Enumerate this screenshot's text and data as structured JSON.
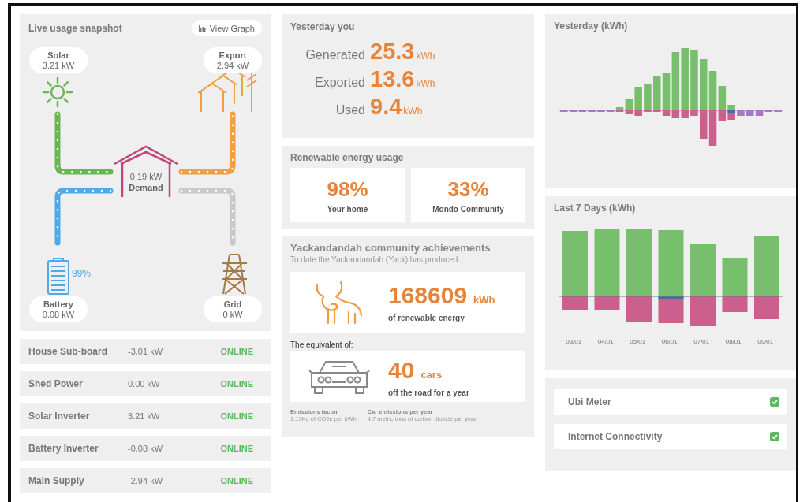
{
  "live": {
    "title": "Live usage snapshot",
    "graph_button": "View Graph",
    "nodes": [
      {
        "kind": "solar",
        "label": "Solar",
        "value": "3.21 kW"
      },
      {
        "kind": "export",
        "label": "Export",
        "value": "2.94 kW"
      },
      {
        "kind": "battery",
        "label": "Battery",
        "value": "0.08 kW",
        "charge": "99%"
      },
      {
        "kind": "grid",
        "label": "Grid",
        "value": "0 kW"
      }
    ],
    "demand": {
      "value": "0.19 kW",
      "label": "Demand"
    }
  },
  "circuits": [
    {
      "name": "House Sub-board",
      "power": "-3.01 kW",
      "status": "ONLINE"
    },
    {
      "name": "Shed Power",
      "power": "0.00 kW",
      "status": "ONLINE"
    },
    {
      "name": "Solar Inverter",
      "power": "3.21 kW",
      "status": "ONLINE"
    },
    {
      "name": "Battery Inverter",
      "power": "-0.08 kW",
      "status": "ONLINE"
    },
    {
      "name": "Main Supply",
      "power": "-2.94 kW",
      "status": "ONLINE"
    }
  ],
  "yesterday": {
    "title": "Yesterday you",
    "stats": [
      {
        "label": "Generated",
        "value": "25.3",
        "unit": "kWh"
      },
      {
        "label": "Exported",
        "value": "13.6",
        "unit": "kWh"
      },
      {
        "label": "Used",
        "value": "9.4",
        "unit": "kWh"
      }
    ]
  },
  "renewable": {
    "title": "Renewable energy usage",
    "cards": [
      {
        "value": "98%",
        "label": "Your home"
      },
      {
        "value": "33%",
        "label": "Mondo Community"
      }
    ]
  },
  "community": {
    "title": "Yackandandah community achievements",
    "subtitle": "To date the Yackandandah (Yack) has produced.",
    "energy": {
      "value": "168609",
      "unit": "kWh",
      "caption": "of renewable energy"
    },
    "equivalent_label": "The equivalent of:",
    "cars": {
      "value": "40",
      "unit": "cars",
      "caption": "off the road for a year"
    },
    "notes": [
      {
        "title": "Emissions factor",
        "text": "1.13Kg of CO2e per kWh"
      },
      {
        "title": "Car emissions per year",
        "text": "4.7 metric tons of carbon dioxide per year"
      }
    ]
  },
  "yesterday_chart": {
    "title": "Yesterday (kWh)"
  },
  "week_chart": {
    "title": "Last 7 Days (kWh)",
    "dates": [
      "03/01",
      "04/01",
      "05/01",
      "06/01",
      "07/01",
      "08/01",
      "09/01"
    ]
  },
  "checks": [
    {
      "label": "Ubi Meter",
      "checked": true
    },
    {
      "label": "Internet Connectivity",
      "checked": true
    }
  ]
}
